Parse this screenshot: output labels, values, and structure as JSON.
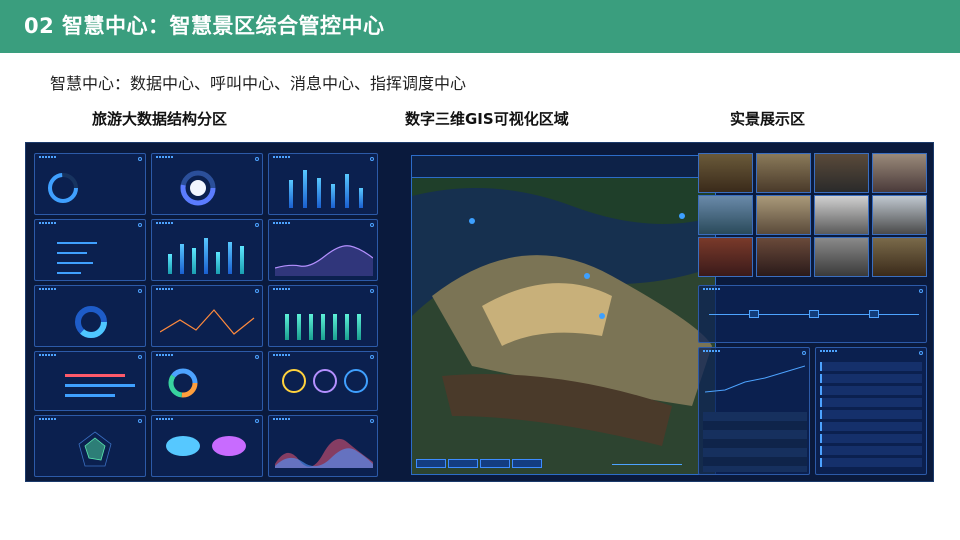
{
  "header": {
    "title": "02 智慧中心：智慧景区综合管控中心"
  },
  "subtitle": "智慧中心：数据中心、呼叫中心、消息中心、指挥调度中心",
  "sections": {
    "left": "旅游大数据结构分区",
    "middle": "数字三维GIS可视化区域",
    "right": "实景展示区"
  },
  "colors": {
    "header": "#3a9e7e",
    "screen_bg": "#0a1a3d",
    "accent": "#4da3ff"
  }
}
